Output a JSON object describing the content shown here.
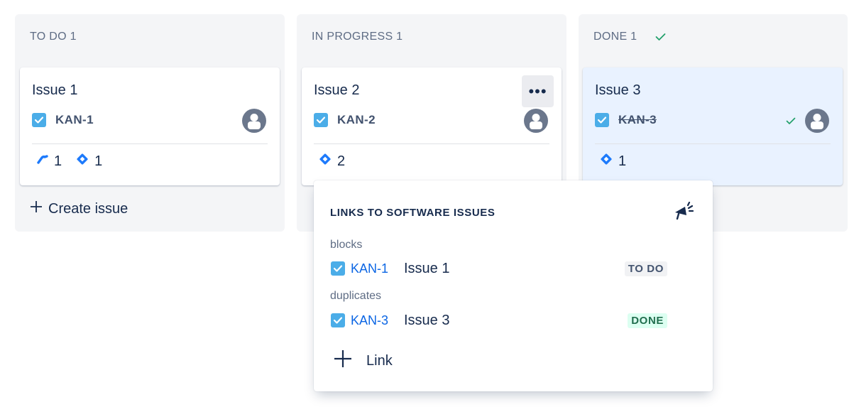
{
  "columns": [
    {
      "header": "TO DO 1",
      "card": {
        "title": "Issue 1",
        "key": "KAN-1",
        "badges": [
          {
            "icon": "subtask-link-icon",
            "count": "1"
          },
          {
            "icon": "diamond-link-icon",
            "count": "1"
          }
        ]
      },
      "create_label": "Create issue"
    },
    {
      "header": "IN PROGRESS 1",
      "card": {
        "title": "Issue 2",
        "key": "KAN-2",
        "more_label": "•••",
        "badges": [
          {
            "icon": "diamond-link-icon",
            "count": "2"
          }
        ]
      }
    },
    {
      "header": "DONE 1",
      "card": {
        "title": "Issue 3",
        "key": "KAN-3",
        "badges": [
          {
            "icon": "diamond-link-icon",
            "count": "1"
          }
        ]
      }
    }
  ],
  "popup": {
    "title": "LINKS TO SOFTWARE ISSUES",
    "groups": [
      {
        "relation": "blocks",
        "key": "KAN-1",
        "summary": "Issue 1",
        "status": "TO DO"
      },
      {
        "relation": "duplicates",
        "key": "KAN-3",
        "summary": "Issue 3",
        "status": "DONE"
      }
    ],
    "add_link_label": "Link"
  },
  "colors": {
    "column_bg": "#f4f5f7",
    "done_card_bg": "#e9f2ff",
    "issue_type_blue": "#4bade8",
    "link_blue": "#0c66e4",
    "done_green": "#22a06b"
  }
}
